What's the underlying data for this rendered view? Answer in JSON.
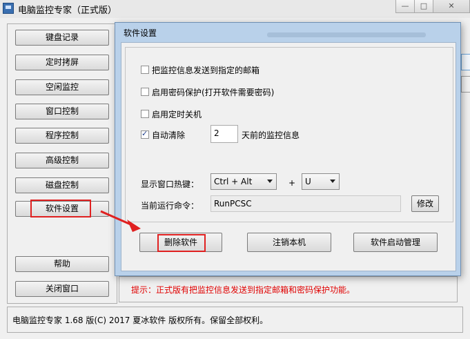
{
  "main_window": {
    "title": "电脑监控专家（正式版）",
    "caption_buttons": {
      "minimize": "—",
      "maximize": "□",
      "close": "✕"
    },
    "sidebar": [
      {
        "label": "键盘记录"
      },
      {
        "label": "定时拷屏"
      },
      {
        "label": "空闲监控"
      },
      {
        "label": "窗口控制"
      },
      {
        "label": "程序控制"
      },
      {
        "label": "高级控制"
      },
      {
        "label": "磁盘控制"
      },
      {
        "label": "软件设置",
        "highlighted": true
      },
      {
        "label": "帮助"
      },
      {
        "label": "关闭窗口"
      }
    ],
    "hint": "提示：正式版有把监控信息发送到指定邮箱和密码保护功能。",
    "copyright": "电脑监控专家 1.68 版(C) 2017 夏冰软件 版权所有。保留全部权利。",
    "hint_color": "#e00000"
  },
  "dialog": {
    "title": "软件设置",
    "options": [
      {
        "label": "把监控信息发送到指定的邮箱",
        "checked": false
      },
      {
        "label": "启用密码保护(打开软件需要密码)",
        "checked": false
      },
      {
        "label": "启用定时关机",
        "checked": false
      },
      {
        "label": "自动清除",
        "checked": true
      }
    ],
    "auto_clear_days": "2",
    "auto_clear_suffix": "天前的监控信息",
    "hotkey_label": "显示窗口热键：",
    "hotkey_modifier": "Ctrl + Alt",
    "hotkey_plus": "+",
    "hotkey_key": "U",
    "command_label": "当前运行命令：",
    "command_value": "RunPCSC",
    "modify_button": "修改",
    "buttons": {
      "delete": "删除软件",
      "logoff": "注销本机",
      "startup": "软件启动管理"
    }
  },
  "annotation_color": "#e02020"
}
